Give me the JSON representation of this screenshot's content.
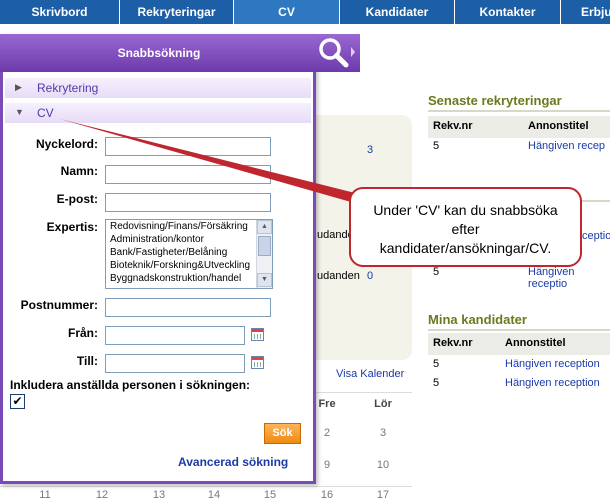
{
  "nav": {
    "tabs": [
      "Skrivbord",
      "Rekryteringar",
      "CV",
      "Kandidater",
      "Kontakter",
      "Erbju"
    ]
  },
  "quick_search": {
    "title": "Snabbsökning",
    "accordion": [
      {
        "label": "Rekrytering",
        "expanded": false
      },
      {
        "label": "CV",
        "expanded": true
      }
    ],
    "fields": {
      "keyword_label": "Nyckelord:",
      "keyword_value": "",
      "name_label": "Namn:",
      "name_value": "",
      "email_label": "E-post:",
      "email_value": "",
      "expertise_label": "Expertis:",
      "expertise_options": [
        "Redovisning/Finans/Försäkring",
        "Administration/kontor",
        "Bank/Fastigheter/Belåning",
        "Bioteknik/Forskning&Utveckling",
        "Byggnadskonstruktion/handel"
      ],
      "postcode_label": "Postnummer:",
      "postcode_value": "",
      "from_label": "Från:",
      "from_value": "",
      "to_label": "Till:",
      "to_value": "",
      "include_employed_label": "Inkludera anställda personen i sökningen:",
      "include_employed_checked": true,
      "checkbox_mark": "✔"
    },
    "search_button": "Sök",
    "advanced_link": "Avancerad sökning"
  },
  "background": {
    "count_3": "3",
    "partial_text_1": "udanden",
    "partial_text_2": "udanden",
    "count_0": "0",
    "show_calendar": "Visa Kalender",
    "calendar": {
      "headers": [
        "Fre",
        "Lör"
      ],
      "row1": [
        "2",
        "3"
      ],
      "row2": [
        "9",
        "10"
      ],
      "row3": [
        "16",
        "17"
      ],
      "bottom_row": [
        "11",
        "12",
        "13",
        "14",
        "15",
        "16",
        "17"
      ]
    },
    "latest_recruitments": {
      "title": "Senaste rekryteringar",
      "col1": "Rekv.nr",
      "col2": "Annonstitel",
      "rows": [
        {
          "nr": "5",
          "title": "Hängiven recep"
        }
      ]
    },
    "mid_rows": [
      {
        "nr": "",
        "title": "ceptio"
      },
      {
        "nr": "5",
        "title": "Hängiven receptio"
      }
    ],
    "my_candidates": {
      "title": "Mina kandidater",
      "col1": "Rekv.nr",
      "col2": "Annonstitel",
      "rows": [
        {
          "nr": "5",
          "title": "Hängiven reception"
        },
        {
          "nr": "5",
          "title": "Hängiven reception"
        }
      ]
    }
  },
  "callout": {
    "line1": "Under 'CV' kan du snabbsöka",
    "line2": "efter",
    "line3": "kandidater/ansökningar/CV."
  }
}
